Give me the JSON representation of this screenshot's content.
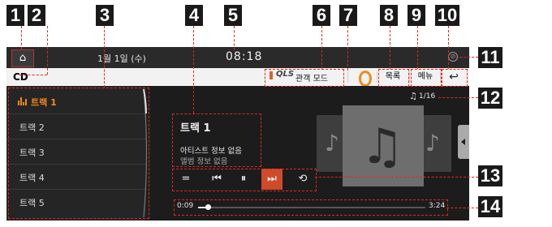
{
  "callouts": [
    "1",
    "2",
    "3",
    "4",
    "5",
    "6",
    "7",
    "8",
    "9",
    "10",
    "11",
    "12",
    "13",
    "14"
  ],
  "top_bar": {
    "home_glyph": "⌂",
    "date": "1월 1일 (수)",
    "clock": "08:18",
    "status_glyph": "⊘"
  },
  "source_bar": {
    "source": "CD",
    "qls_logo": "QLS",
    "mode_label": "관객 모드",
    "list_label": "목록",
    "menu_label": "메뉴",
    "back_glyph": "↩"
  },
  "track_list": {
    "items": [
      {
        "label": "트랙 1",
        "active": true
      },
      {
        "label": "트랙 2",
        "active": false
      },
      {
        "label": "트랙 3",
        "active": false
      },
      {
        "label": "트랙 4",
        "active": false
      },
      {
        "label": "트랙 5",
        "active": false
      }
    ]
  },
  "now_playing": {
    "track_count": "1/16",
    "title": "트랙 1",
    "artist": "아티스트 정보 없음",
    "album": "앨범 정보 없음"
  },
  "controls": {
    "list_glyph": "=",
    "prev_glyph": "⏮",
    "pause_glyph": "⏸",
    "next_glyph": "⏭",
    "repeat_glyph": "⟲"
  },
  "progress": {
    "elapsed": "0:09",
    "total": "3:24",
    "fraction": 0.044
  },
  "icons": {
    "home": "home-icon",
    "status": "no-signal-icon",
    "equalizer": "equalizer-icon",
    "music_note": "music-note-icon",
    "back": "back-icon"
  },
  "colors": {
    "accent": "#f08a1c",
    "callout_line": "#e0281e",
    "active_control": "#cf4a2a",
    "callout_badge": "#1a1a1a"
  }
}
